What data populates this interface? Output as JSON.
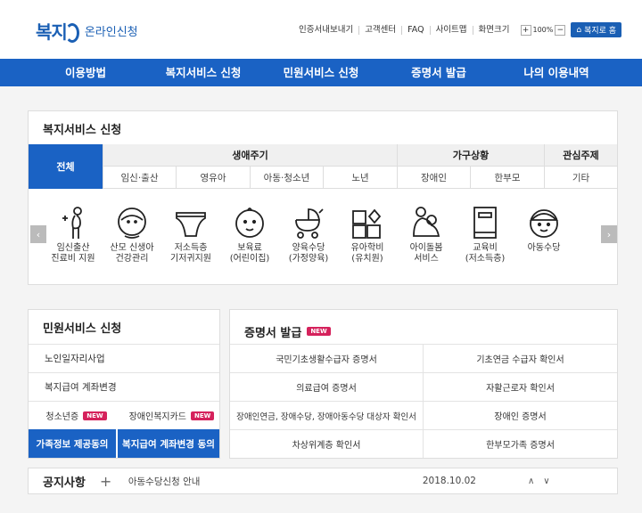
{
  "header": {
    "logo_mark": "복지",
    "logo_text": "온라인신청",
    "links": [
      "인증서내보내기",
      "고객센터",
      "FAQ",
      "사이트맵",
      "화면크기"
    ],
    "zoom_plus": "+",
    "zoom_level": "100%",
    "zoom_minus": "−",
    "home_button": "복지로 홈"
  },
  "main_nav": [
    "이용방법",
    "복지서비스 신청",
    "민원서비스 신청",
    "증명서 발급",
    "나의 이용내역"
  ],
  "welfare": {
    "title": "복지서비스 신청",
    "all_tab": "전체",
    "groups": [
      "생애주기",
      "가구상황",
      "관심주제"
    ],
    "subs": [
      "임신·출산",
      "영유아",
      "아동·청소년",
      "노년",
      "장애인",
      "한부모",
      "기타"
    ],
    "prev": "‹",
    "next": "›",
    "services": [
      {
        "label": "임신출산\n진료비 지원",
        "icon": "pregnant-icon"
      },
      {
        "label": "산모 신생아\n건강관리",
        "icon": "newborn-icon"
      },
      {
        "label": "저소득층\n기저귀지원",
        "icon": "diaper-icon"
      },
      {
        "label": "보육료\n(어린이집)",
        "icon": "baby-face-icon"
      },
      {
        "label": "양육수당\n(가정양육)",
        "icon": "stroller-icon"
      },
      {
        "label": "유아학비\n(유치원)",
        "icon": "blocks-icon"
      },
      {
        "label": "아이돌봄\n서비스",
        "icon": "caregiver-icon"
      },
      {
        "label": "교육비\n(저소득층)",
        "icon": "book-icon"
      },
      {
        "label": "아동수당",
        "icon": "child-icon"
      }
    ]
  },
  "civil": {
    "title": "민원서비스 신청",
    "rows": [
      "노인일자리사업",
      "복지급여 계좌변경"
    ],
    "half_items": [
      "청소년증",
      "장애인복지카드"
    ],
    "new_badge": "NEW",
    "buttons": [
      "가족정보 제공동의",
      "복지급여 계좌변경 동의"
    ]
  },
  "cert": {
    "title": "증명서 발급",
    "new_badge": "NEW",
    "items": [
      "국민기초생활수급자 증명서",
      "기초연금 수급자 확인서",
      "의료급여 증명서",
      "자활근로자 확인서",
      "장애인연금, 장애수당, 장애아동수당 대상자 확인서",
      "장애인 증명서",
      "차상위계층 확인서",
      "한부모가족 증명서"
    ]
  },
  "notice": {
    "title": "공지사항",
    "plus": "+",
    "text": "아동수당신청 안내",
    "date": "2018.10.02",
    "up": "∧",
    "down": "∨"
  },
  "colors": {
    "primary": "#1a62c4",
    "badge": "#d5225c"
  }
}
